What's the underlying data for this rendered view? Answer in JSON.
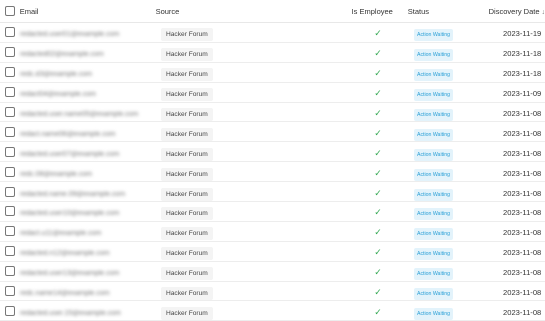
{
  "table": {
    "columns": {
      "email": "Email",
      "source": "Source",
      "is_employee": "Is Employee",
      "status": "Status",
      "discovery_date": "Discovery Date"
    },
    "sort_icon": "arrow-down-icon",
    "rows": [
      {
        "email": "redacted.user01@example.com",
        "source": "Hacker Forum",
        "is_employee": true,
        "status": "Action Waiting",
        "date": "2023-11-19"
      },
      {
        "email": "redacted02@example.com",
        "source": "Hacker Forum",
        "is_employee": true,
        "status": "Action Waiting",
        "date": "2023-11-18"
      },
      {
        "email": "redc.d3@example.com",
        "source": "Hacker Forum",
        "is_employee": true,
        "status": "Action Waiting",
        "date": "2023-11-18"
      },
      {
        "email": "redact04@example.com",
        "source": "Hacker Forum",
        "is_employee": true,
        "status": "Action Waiting",
        "date": "2023-11-09"
      },
      {
        "email": "redacted.user.name05@example.com",
        "source": "Hacker Forum",
        "is_employee": true,
        "status": "Action Waiting",
        "date": "2023-11-08"
      },
      {
        "email": "redact.name06@example.com",
        "source": "Hacker Forum",
        "is_employee": true,
        "status": "Action Waiting",
        "date": "2023-11-08"
      },
      {
        "email": "redacted.user07@example.com",
        "source": "Hacker Forum",
        "is_employee": true,
        "status": "Action Waiting",
        "date": "2023-11-08"
      },
      {
        "email": "redc.08@example.com",
        "source": "Hacker Forum",
        "is_employee": true,
        "status": "Action Waiting",
        "date": "2023-11-08"
      },
      {
        "email": "redacted.name.09@example.com",
        "source": "Hacker Forum",
        "is_employee": true,
        "status": "Action Waiting",
        "date": "2023-11-08"
      },
      {
        "email": "redacted.user10@example.com",
        "source": "Hacker Forum",
        "is_employee": true,
        "status": "Action Waiting",
        "date": "2023-11-08"
      },
      {
        "email": "redact.u11@example.com",
        "source": "Hacker Forum",
        "is_employee": true,
        "status": "Action Waiting",
        "date": "2023-11-08"
      },
      {
        "email": "redacted.n12@example.com",
        "source": "Hacker Forum",
        "is_employee": true,
        "status": "Action Waiting",
        "date": "2023-11-08"
      },
      {
        "email": "redacted.user13@example.com",
        "source": "Hacker Forum",
        "is_employee": true,
        "status": "Action Waiting",
        "date": "2023-11-08"
      },
      {
        "email": "redc.name14@example.com",
        "source": "Hacker Forum",
        "is_employee": true,
        "status": "Action Waiting",
        "date": "2023-11-08"
      },
      {
        "email": "redacted.user.15@example.com",
        "source": "Hacker Forum",
        "is_employee": true,
        "status": "Action Waiting",
        "date": "2023-11-08"
      }
    ]
  },
  "colors": {
    "check": "#34a853",
    "status_text": "#2a9fd6",
    "status_bg": "#e3f3fb",
    "tag_bg": "#f4f4f4"
  }
}
